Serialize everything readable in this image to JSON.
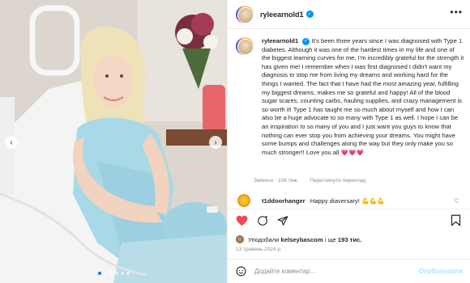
{
  "post": {
    "username": "ryleearnold1",
    "more_icon": "more-options-icon",
    "caption_username": "ryleearnold1",
    "caption_text": "It's been three years since I was diagnosed with Type 1 diabetes. Although it was one of the hardest times in my life and one of the biggest learning curves for me, I'm incredibly grateful for the strength it has given me! I remember when I was first diagnosed I didn't want my diagnosis to stop me from living my dreams and working hard for the things I wanted. The fact that I have had the most amazing year, fulfilling my biggest dreams, makes me so grateful and happy! All of the blood sugar scares, counting carbs, hauling supplies, and crazy management is so worth it! Type 1 has taught me so much about myself and how I can also be a huge advocate to so many with Type 1 as well. I hope I can be an inspiration to so many of you and I just want you guys to know that nothing can ever stop you from achieving your dreams. You might have some bumps and challenges along the way but they only make you so much stronger!! Love you all",
    "caption_hearts": "💗💗💗",
    "edited": "Змінено · 106 тиж.",
    "translate": "Переглянути переклад"
  },
  "comment": {
    "username": "t1ddoorhanger",
    "text": "Happy diaversary!",
    "emoji": "💪💪💪"
  },
  "likes": {
    "prefix": "Уподобали",
    "user": "kelseybascom",
    "suffix": "і ще",
    "count": "193 тис."
  },
  "date": "13 травень 2024 р.",
  "comment_bar": {
    "placeholder": "Додайте коментар...",
    "publish": "Опублікувати"
  },
  "carousel": {
    "dots": 6,
    "active": 0
  },
  "colors": {
    "accent": "#0095f6",
    "like": "#ed4956",
    "publish_disabled": "#b2dffc"
  }
}
